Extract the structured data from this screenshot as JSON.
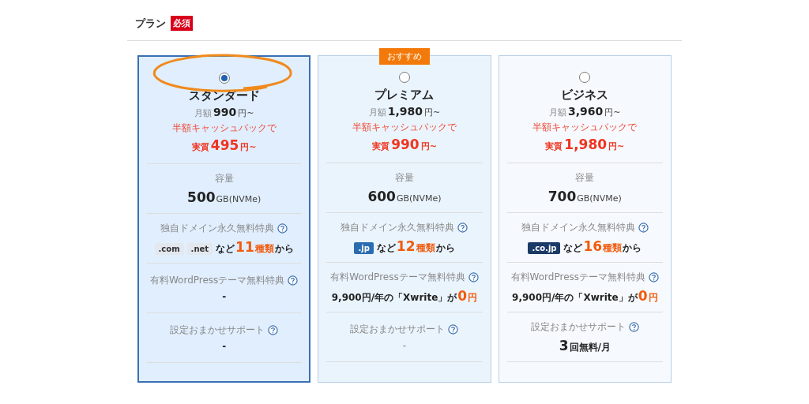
{
  "section": {
    "title": "プラン",
    "required_badge": "必須"
  },
  "plans": [
    {
      "name": "スタンダード",
      "selected": true,
      "annotated": true,
      "price_label": "月額",
      "price": "990",
      "price_unit": "円~",
      "cashback": "半額キャッシュバックで",
      "real_label": "実質",
      "real_price": "495",
      "real_unit": "円~",
      "features": [
        {
          "label": "容量",
          "help": false,
          "segments": [
            {
              "text": "500",
              "kind": "big"
            },
            {
              "text": "GB(NVMe)",
              "kind": "unit"
            }
          ]
        },
        {
          "label": "独自ドメイン永久無料特典",
          "help": true,
          "tags": [
            {
              "text": ".com",
              "color": "#e3e8ee"
            },
            {
              "text": ".net",
              "color": "#e3e8ee"
            }
          ],
          "segments": [
            {
              "text": "など",
              "kind": "bold"
            },
            {
              "text": "11",
              "kind": "big-orange"
            },
            {
              "text": "種類",
              "kind": "small-orange"
            },
            {
              "text": "から",
              "kind": "bold"
            }
          ]
        },
        {
          "label": "有料WordPressテーマ無料特典",
          "help": true,
          "segments": [
            {
              "text": "-",
              "kind": "bold"
            }
          ]
        },
        {
          "label": "設定おまかせサポート",
          "help": true,
          "segments": [
            {
              "text": "-",
              "kind": "bold"
            }
          ]
        }
      ]
    },
    {
      "name": "プレミアム",
      "selected": false,
      "annotated": false,
      "badge": "おすすめ",
      "price_label": "月額",
      "price": "1,980",
      "price_unit": "円~",
      "cashback": "半額キャッシュバックで",
      "real_label": "実質",
      "real_price": "990",
      "real_unit": "円~",
      "features": [
        {
          "label": "容量",
          "help": false,
          "segments": [
            {
              "text": "600",
              "kind": "big"
            },
            {
              "text": "GB(NVMe)",
              "kind": "unit"
            }
          ]
        },
        {
          "label": "独自ドメイン永久無料特典",
          "help": true,
          "tags": [
            {
              "text": ".jp",
              "color": "#2b6cb0"
            }
          ],
          "segments": [
            {
              "text": "など",
              "kind": "bold"
            },
            {
              "text": "12",
              "kind": "big-orange"
            },
            {
              "text": "種類",
              "kind": "small-orange"
            },
            {
              "text": "から",
              "kind": "bold"
            }
          ]
        },
        {
          "label": "有料WordPressテーマ無料特典",
          "help": true,
          "segments": [
            {
              "text": "9,900円/年の「Xwrite」が",
              "kind": "bold"
            },
            {
              "text": "0",
              "kind": "big-orange"
            },
            {
              "text": "円",
              "kind": "small-orange"
            }
          ]
        },
        {
          "label": "設定おまかせサポート",
          "help": true,
          "segments": [
            {
              "text": "-",
              "kind": "light"
            }
          ]
        }
      ]
    },
    {
      "name": "ビジネス",
      "selected": false,
      "annotated": false,
      "price_label": "月額",
      "price": "3,960",
      "price_unit": "円~",
      "cashback": "半額キャッシュバックで",
      "real_label": "実質",
      "real_price": "1,980",
      "real_unit": "円~",
      "features": [
        {
          "label": "容量",
          "help": false,
          "segments": [
            {
              "text": "700",
              "kind": "big"
            },
            {
              "text": "GB(NVMe)",
              "kind": "unit"
            }
          ]
        },
        {
          "label": "独自ドメイン永久無料特典",
          "help": true,
          "tags": [
            {
              "text": ".co.jp",
              "color": "#1b3a66"
            }
          ],
          "segments": [
            {
              "text": "など",
              "kind": "bold"
            },
            {
              "text": "16",
              "kind": "big-orange"
            },
            {
              "text": "種類",
              "kind": "small-orange"
            },
            {
              "text": "から",
              "kind": "bold"
            }
          ]
        },
        {
          "label": "有料WordPressテーマ無料特典",
          "help": true,
          "segments": [
            {
              "text": "9,900円/年の「Xwrite」が",
              "kind": "bold"
            },
            {
              "text": "0",
              "kind": "big-orange"
            },
            {
              "text": "円",
              "kind": "small-orange"
            }
          ]
        },
        {
          "label": "設定おまかせサポート",
          "help": true,
          "segments": [
            {
              "text": "3",
              "kind": "big"
            },
            {
              "text": "回無料/月",
              "kind": "bold"
            }
          ]
        }
      ]
    }
  ]
}
